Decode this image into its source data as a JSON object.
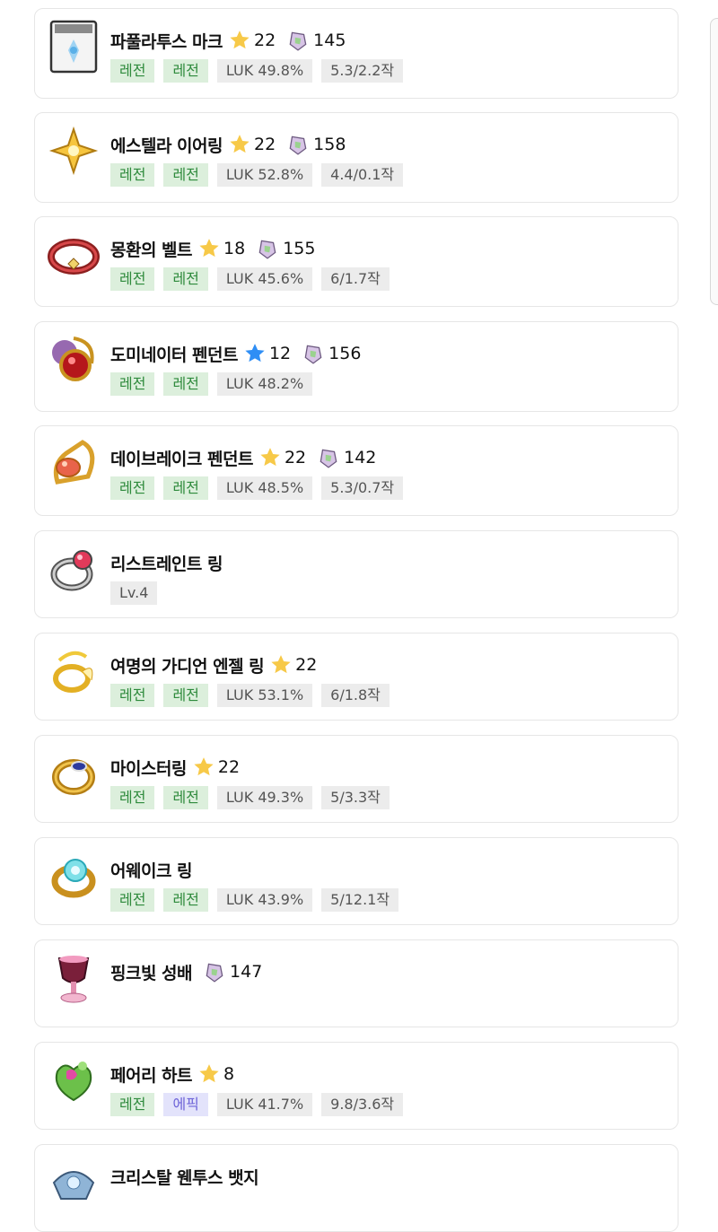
{
  "items": [
    {
      "name": "파풀라투스 마크",
      "star": "22",
      "star_color": "gold",
      "power": "145",
      "tags": [
        "레전",
        "레전",
        "LUK 49.8%",
        "5.3/2.2작"
      ],
      "icon": "papulatus-mark-icon"
    },
    {
      "name": "에스텔라 이어링",
      "star": "22",
      "star_color": "gold",
      "power": "158",
      "tags": [
        "레전",
        "레전",
        "LUK 52.8%",
        "4.4/0.1작"
      ],
      "icon": "estella-earring-icon"
    },
    {
      "name": "몽환의 벨트",
      "star": "18",
      "star_color": "gold",
      "power": "155",
      "tags": [
        "레전",
        "레전",
        "LUK 45.6%",
        "6/1.7작"
      ],
      "icon": "dreamy-belt-icon"
    },
    {
      "name": "도미네이터 펜던트",
      "star": "12",
      "star_color": "blue",
      "power": "156",
      "tags": [
        "레전",
        "레전",
        "LUK 48.2%"
      ],
      "icon": "dominator-pendant-icon"
    },
    {
      "name": "데이브레이크 펜던트",
      "star": "22",
      "star_color": "gold",
      "power": "142",
      "tags": [
        "레전",
        "레전",
        "LUK 48.5%",
        "5.3/0.7작"
      ],
      "icon": "daybreak-pendant-icon"
    },
    {
      "name": "리스트레인트 링",
      "star": "",
      "star_color": "",
      "power": "",
      "tags": [
        "Lv.4"
      ],
      "icon": "restraint-ring-icon"
    },
    {
      "name": "여명의 가디언 엔젤 링",
      "star": "22",
      "star_color": "gold",
      "power": "",
      "tags": [
        "레전",
        "레전",
        "LUK 53.1%",
        "6/1.8작"
      ],
      "icon": "guardian-angel-ring-icon"
    },
    {
      "name": "마이스터링",
      "star": "22",
      "star_color": "gold",
      "power": "",
      "tags": [
        "레전",
        "레전",
        "LUK 49.3%",
        "5/3.3작"
      ],
      "icon": "meister-ring-icon"
    },
    {
      "name": "어웨이크 링",
      "star": "",
      "star_color": "",
      "power": "",
      "tags": [
        "레전",
        "레전",
        "LUK 43.9%",
        "5/12.1작"
      ],
      "icon": "awake-ring-icon"
    },
    {
      "name": "핑크빛 성배",
      "star": "",
      "star_color": "",
      "power": "147",
      "tags": [],
      "icon": "pink-holy-cup-icon"
    },
    {
      "name": "페어리 하트",
      "star": "8",
      "star_color": "gold",
      "power": "",
      "tags": [
        "레전",
        "에픽",
        "LUK 41.7%",
        "9.8/3.6작"
      ],
      "icon": "fairy-heart-icon"
    },
    {
      "name": "크리스탈 웬투스 뱃지",
      "star": "",
      "star_color": "",
      "power": "",
      "tags": [],
      "icon": "crystal-ventus-badge-icon"
    }
  ],
  "colors": {
    "gold_star": "#f7c948",
    "blue_star": "#2f8ef5",
    "legendary_bg": "#dcefdc",
    "legendary_fg": "#2e8a3c",
    "epic_bg": "#e3e3fb",
    "epic_fg": "#6e64d8"
  }
}
